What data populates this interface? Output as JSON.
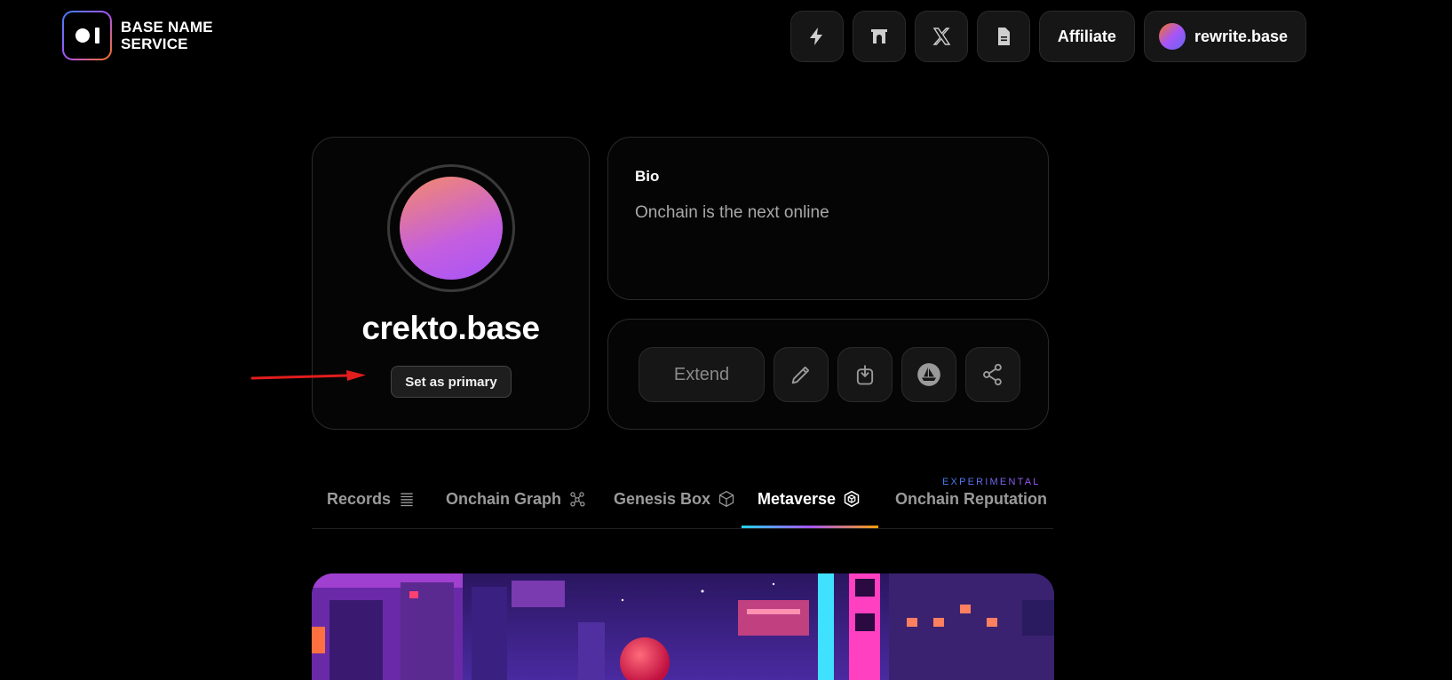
{
  "header": {
    "brand_line1": "BASE NAME",
    "brand_line2": "SERVICE",
    "nav_icons": [
      "lightning-icon",
      "gate-icon",
      "x-icon",
      "document-icon"
    ],
    "affiliate_label": "Affiliate",
    "account_name": "rewrite.base"
  },
  "profile": {
    "name": "crekto.base",
    "set_primary_label": "Set as primary"
  },
  "bio": {
    "title": "Bio",
    "text": "Onchain is the next online"
  },
  "actions": {
    "extend_label": "Extend",
    "icons": [
      "pencil-icon",
      "download-icon",
      "opensea-icon",
      "share-icon"
    ]
  },
  "tabs": {
    "items": [
      {
        "label": "Records",
        "icon": "list-icon"
      },
      {
        "label": "Onchain Graph",
        "icon": "graph-icon"
      },
      {
        "label": "Genesis Box",
        "icon": "box-icon"
      },
      {
        "label": "Metaverse",
        "icon": "hexagon-cube-icon"
      },
      {
        "label": "Onchain Reputation",
        "icon": ""
      }
    ],
    "active": "Metaverse",
    "experimental_badge": "EXPERIMENTAL"
  },
  "colors": {
    "background": "#000000",
    "card_border": "#2a2a2a",
    "accent_gradient": [
      "#22d3ee",
      "#a855f7",
      "#f59e0b"
    ],
    "annotation_arrow": "#e11d1d"
  }
}
